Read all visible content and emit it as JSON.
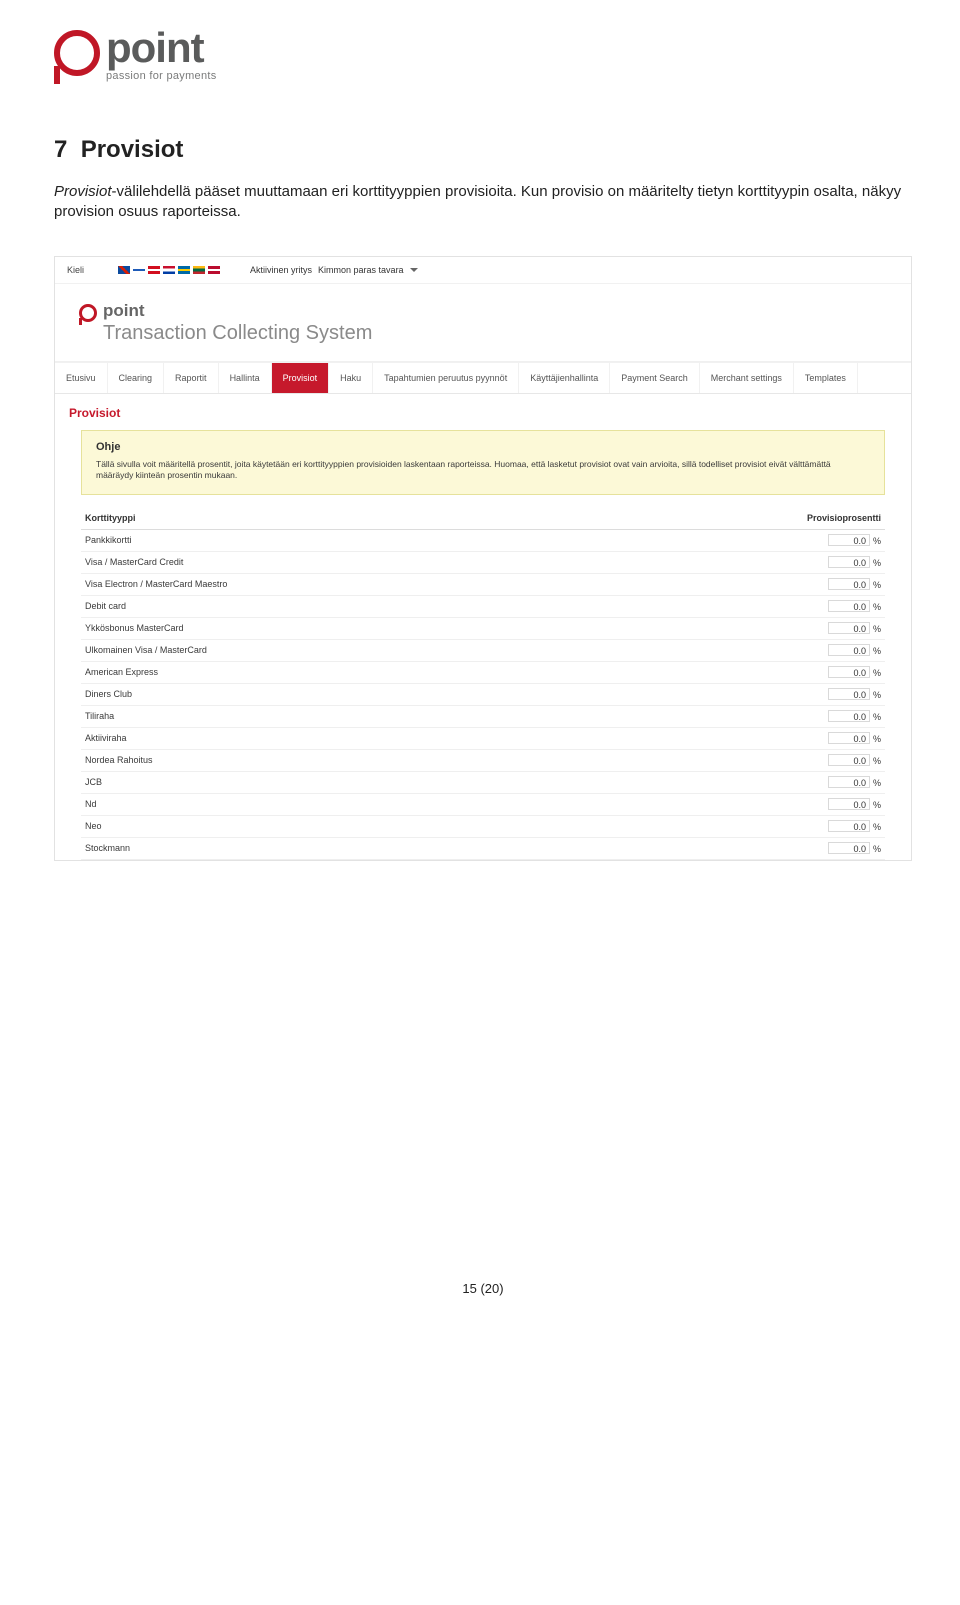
{
  "logo": {
    "word": "point",
    "tagline": "passion for payments"
  },
  "section": {
    "number": "7",
    "title": "Provisiot"
  },
  "paragraph": {
    "italic": "Provisiot",
    "rest": "-välilehdellä pääset muuttamaan eri korttityyppien provisioita. Kun provisio on määritelty tietyn korttityypin osalta, näkyy provision osuus raporteissa."
  },
  "screenshot": {
    "topbar": {
      "kieli_label": "Kieli",
      "active_label": "Aktiivinen yritys",
      "active_value": "Kimmon paras tavara"
    },
    "header": {
      "point": "point",
      "sub": "Transaction Collecting System"
    },
    "nav": [
      "Etusivu",
      "Clearing",
      "Raportit",
      "Hallinta",
      "Provisiot",
      "Haku",
      "Tapahtumien peruutus pyynnöt",
      "Käyttäjienhallinta",
      "Payment Search",
      "Merchant settings",
      "Templates"
    ],
    "nav_active_index": 4,
    "red_heading": "Provisiot",
    "ohje": {
      "title": "Ohje",
      "text": "Tällä sivulla voit määritellä prosentit, joita käytetään eri korttityyppien provisioiden laskentaan raporteissa. Huomaa, että lasketut provisiot ovat vain arvioita, sillä todelliset provisiot eivät välttämättä määräydy kiinteän prosentin mukaan."
    },
    "table": {
      "col_type": "Korttityyppi",
      "col_pct": "Provisioprosentti",
      "rows": [
        {
          "label": "Pankkikortti",
          "value": "0.0"
        },
        {
          "label": "Visa / MasterCard Credit",
          "value": "0.0"
        },
        {
          "label": "Visa Electron / MasterCard Maestro",
          "value": "0.0"
        },
        {
          "label": "Debit card",
          "value": "0.0"
        },
        {
          "label": "Ykkösbonus MasterCard",
          "value": "0.0"
        },
        {
          "label": "Ulkomainen Visa / MasterCard",
          "value": "0.0"
        },
        {
          "label": "American Express",
          "value": "0.0"
        },
        {
          "label": "Diners Club",
          "value": "0.0"
        },
        {
          "label": "Tiliraha",
          "value": "0.0"
        },
        {
          "label": "Aktiiviraha",
          "value": "0.0"
        },
        {
          "label": "Nordea Rahoitus",
          "value": "0.0"
        },
        {
          "label": "JCB",
          "value": "0.0"
        },
        {
          "label": "Nd",
          "value": "0.0"
        },
        {
          "label": "Neo",
          "value": "0.0"
        },
        {
          "label": "Stockmann",
          "value": "0.0"
        }
      ],
      "pct_symbol": "%"
    }
  },
  "page_number": "15 (20)"
}
